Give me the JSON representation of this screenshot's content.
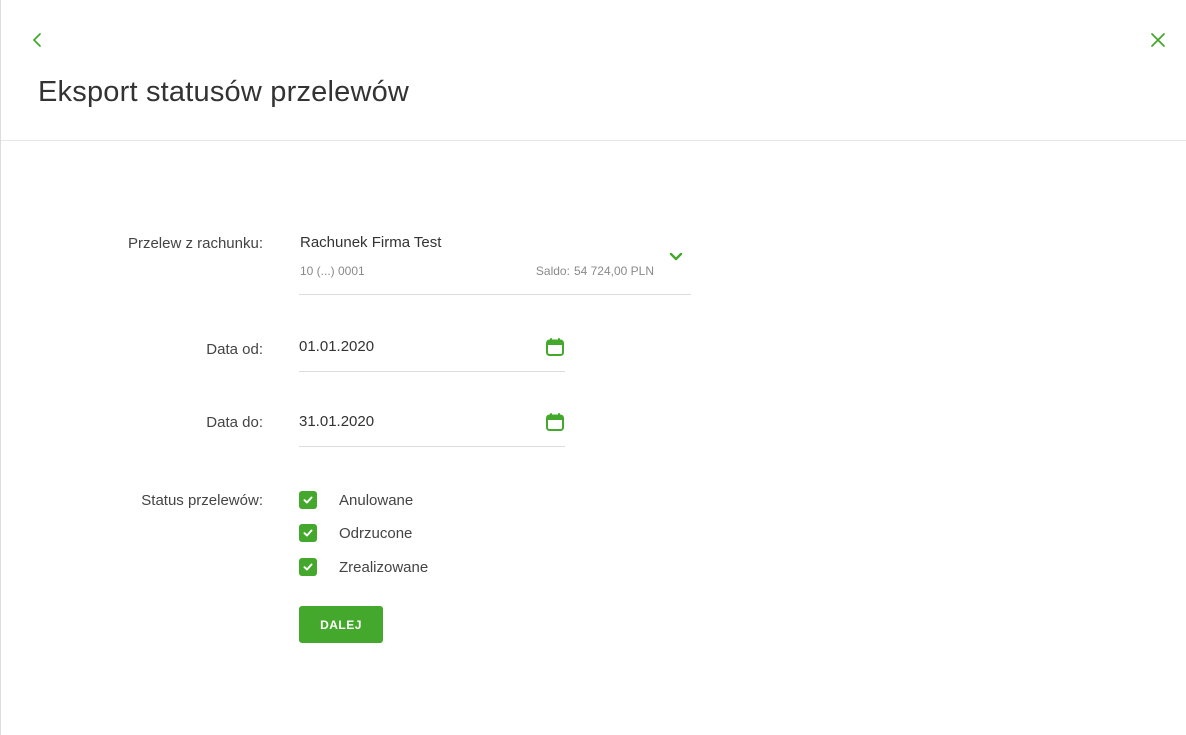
{
  "header": {
    "title": "Eksport statusów przelewów",
    "back_icon": "chevron-left-icon",
    "close_icon": "close-icon"
  },
  "form": {
    "account": {
      "label": "Przelew z rachunku:",
      "name": "Rachunek Firma Test",
      "number": "10 (...) 0001",
      "balance_label": "Saldo:",
      "balance_value": "54 724,00 PLN"
    },
    "date_from": {
      "label": "Data od:",
      "value": "01.01.2020"
    },
    "date_to": {
      "label": "Data do:",
      "value": "31.01.2020"
    },
    "status": {
      "label": "Status przelewów:",
      "options": [
        {
          "label": "Anulowane",
          "checked": true
        },
        {
          "label": "Odrzucone",
          "checked": true
        },
        {
          "label": "Zrealizowane",
          "checked": true
        }
      ]
    },
    "submit_label": "DALEJ"
  },
  "colors": {
    "accent": "#43a82b",
    "text": "#333333",
    "muted": "#8a8a8a",
    "divider": "#dcdcdc"
  }
}
